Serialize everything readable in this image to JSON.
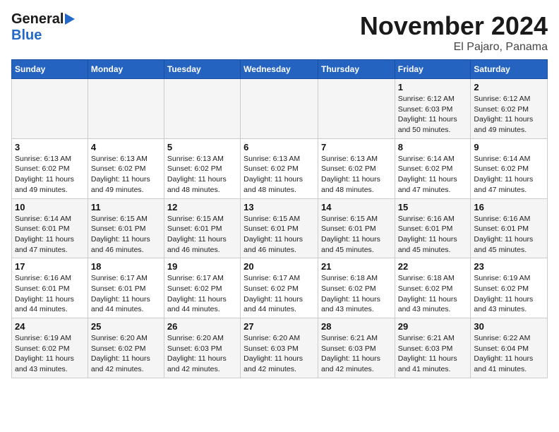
{
  "header": {
    "logo_general": "General",
    "logo_blue": "Blue",
    "title": "November 2024",
    "subtitle": "El Pajaro, Panama"
  },
  "days_of_week": [
    "Sunday",
    "Monday",
    "Tuesday",
    "Wednesday",
    "Thursday",
    "Friday",
    "Saturday"
  ],
  "weeks": [
    [
      {
        "day": "",
        "info": ""
      },
      {
        "day": "",
        "info": ""
      },
      {
        "day": "",
        "info": ""
      },
      {
        "day": "",
        "info": ""
      },
      {
        "day": "",
        "info": ""
      },
      {
        "day": "1",
        "info": "Sunrise: 6:12 AM\nSunset: 6:03 PM\nDaylight: 11 hours and 50 minutes."
      },
      {
        "day": "2",
        "info": "Sunrise: 6:12 AM\nSunset: 6:02 PM\nDaylight: 11 hours and 49 minutes."
      }
    ],
    [
      {
        "day": "3",
        "info": "Sunrise: 6:13 AM\nSunset: 6:02 PM\nDaylight: 11 hours and 49 minutes."
      },
      {
        "day": "4",
        "info": "Sunrise: 6:13 AM\nSunset: 6:02 PM\nDaylight: 11 hours and 49 minutes."
      },
      {
        "day": "5",
        "info": "Sunrise: 6:13 AM\nSunset: 6:02 PM\nDaylight: 11 hours and 48 minutes."
      },
      {
        "day": "6",
        "info": "Sunrise: 6:13 AM\nSunset: 6:02 PM\nDaylight: 11 hours and 48 minutes."
      },
      {
        "day": "7",
        "info": "Sunrise: 6:13 AM\nSunset: 6:02 PM\nDaylight: 11 hours and 48 minutes."
      },
      {
        "day": "8",
        "info": "Sunrise: 6:14 AM\nSunset: 6:02 PM\nDaylight: 11 hours and 47 minutes."
      },
      {
        "day": "9",
        "info": "Sunrise: 6:14 AM\nSunset: 6:02 PM\nDaylight: 11 hours and 47 minutes."
      }
    ],
    [
      {
        "day": "10",
        "info": "Sunrise: 6:14 AM\nSunset: 6:01 PM\nDaylight: 11 hours and 47 minutes."
      },
      {
        "day": "11",
        "info": "Sunrise: 6:15 AM\nSunset: 6:01 PM\nDaylight: 11 hours and 46 minutes."
      },
      {
        "day": "12",
        "info": "Sunrise: 6:15 AM\nSunset: 6:01 PM\nDaylight: 11 hours and 46 minutes."
      },
      {
        "day": "13",
        "info": "Sunrise: 6:15 AM\nSunset: 6:01 PM\nDaylight: 11 hours and 46 minutes."
      },
      {
        "day": "14",
        "info": "Sunrise: 6:15 AM\nSunset: 6:01 PM\nDaylight: 11 hours and 45 minutes."
      },
      {
        "day": "15",
        "info": "Sunrise: 6:16 AM\nSunset: 6:01 PM\nDaylight: 11 hours and 45 minutes."
      },
      {
        "day": "16",
        "info": "Sunrise: 6:16 AM\nSunset: 6:01 PM\nDaylight: 11 hours and 45 minutes."
      }
    ],
    [
      {
        "day": "17",
        "info": "Sunrise: 6:16 AM\nSunset: 6:01 PM\nDaylight: 11 hours and 44 minutes."
      },
      {
        "day": "18",
        "info": "Sunrise: 6:17 AM\nSunset: 6:01 PM\nDaylight: 11 hours and 44 minutes."
      },
      {
        "day": "19",
        "info": "Sunrise: 6:17 AM\nSunset: 6:02 PM\nDaylight: 11 hours and 44 minutes."
      },
      {
        "day": "20",
        "info": "Sunrise: 6:17 AM\nSunset: 6:02 PM\nDaylight: 11 hours and 44 minutes."
      },
      {
        "day": "21",
        "info": "Sunrise: 6:18 AM\nSunset: 6:02 PM\nDaylight: 11 hours and 43 minutes."
      },
      {
        "day": "22",
        "info": "Sunrise: 6:18 AM\nSunset: 6:02 PM\nDaylight: 11 hours and 43 minutes."
      },
      {
        "day": "23",
        "info": "Sunrise: 6:19 AM\nSunset: 6:02 PM\nDaylight: 11 hours and 43 minutes."
      }
    ],
    [
      {
        "day": "24",
        "info": "Sunrise: 6:19 AM\nSunset: 6:02 PM\nDaylight: 11 hours and 43 minutes."
      },
      {
        "day": "25",
        "info": "Sunrise: 6:20 AM\nSunset: 6:02 PM\nDaylight: 11 hours and 42 minutes."
      },
      {
        "day": "26",
        "info": "Sunrise: 6:20 AM\nSunset: 6:03 PM\nDaylight: 11 hours and 42 minutes."
      },
      {
        "day": "27",
        "info": "Sunrise: 6:20 AM\nSunset: 6:03 PM\nDaylight: 11 hours and 42 minutes."
      },
      {
        "day": "28",
        "info": "Sunrise: 6:21 AM\nSunset: 6:03 PM\nDaylight: 11 hours and 42 minutes."
      },
      {
        "day": "29",
        "info": "Sunrise: 6:21 AM\nSunset: 6:03 PM\nDaylight: 11 hours and 41 minutes."
      },
      {
        "day": "30",
        "info": "Sunrise: 6:22 AM\nSunset: 6:04 PM\nDaylight: 11 hours and 41 minutes."
      }
    ]
  ]
}
